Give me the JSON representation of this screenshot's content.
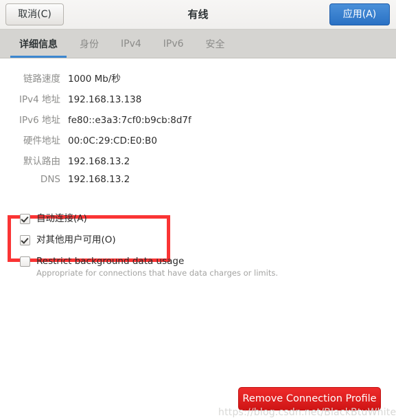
{
  "window": {
    "title": "有线",
    "cancel_label": "取消(C)",
    "apply_label": "应用(A)"
  },
  "tabs": [
    {
      "label": "详细信息",
      "active": true
    },
    {
      "label": "身份",
      "active": false
    },
    {
      "label": "IPv4",
      "active": false
    },
    {
      "label": "IPv6",
      "active": false
    },
    {
      "label": "安全",
      "active": false
    }
  ],
  "details": [
    {
      "label": "链路速度",
      "value": "1000 Mb/秒"
    },
    {
      "label": "IPv4 地址",
      "value": "192.168.13.138"
    },
    {
      "label": "IPv6 地址",
      "value": "fe80::e3a3:7cf0:b9cb:8d7f"
    },
    {
      "label": "硬件地址",
      "value": "00:0C:29:CD:E0:B0"
    },
    {
      "label": "默认路由",
      "value": "192.168.13.2"
    },
    {
      "label": "DNS",
      "value": "192.168.13.2"
    }
  ],
  "options": [
    {
      "label": "自动连接(A)",
      "sublabel": "",
      "checked": true
    },
    {
      "label": "对其他用户可用(O)",
      "sublabel": "",
      "checked": true
    },
    {
      "label": "Restrict background data usage",
      "sublabel": "Appropriate for connections that have data charges or limits.",
      "checked": false
    }
  ],
  "actions": {
    "remove_label": "Remove Connection Profile"
  },
  "annotation": {
    "highlight_color": "#fa3434"
  },
  "watermark": {
    "text": "https://blog.csdn.net/BlackBtuWhite"
  }
}
